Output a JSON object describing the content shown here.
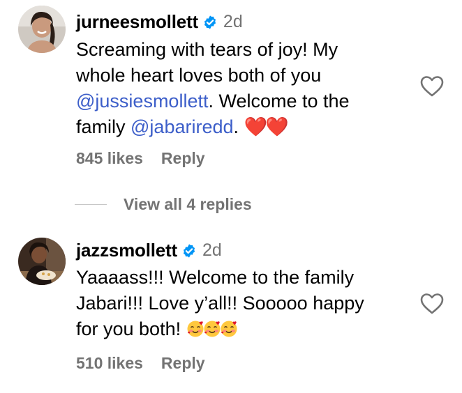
{
  "comments": [
    {
      "username": "jurneesmollett",
      "time": "2d",
      "avatar_icon": "profile-photo-woman-smiling",
      "text_lines": [
        {
          "parts": [
            {
              "t": "Screaming with tears of joy! My"
            }
          ]
        },
        {
          "parts": [
            {
              "t": "whole heart loves both of you"
            }
          ]
        },
        {
          "parts": [
            {
              "t": "@jussiesmollett",
              "mention": true
            },
            {
              "t": ". Welcome to the"
            }
          ]
        },
        {
          "parts": [
            {
              "t": "family "
            },
            {
              "t": "@jabariredd",
              "mention": true
            },
            {
              "t": ". "
            },
            {
              "t": "❤️❤️",
              "hearts": true
            }
          ]
        }
      ],
      "likes": "845 likes",
      "reply_label": "Reply",
      "view_replies": "View all 4 replies"
    },
    {
      "username": "jazzsmollett",
      "time": "2d",
      "avatar_icon": "profile-photo-woman-with-cake",
      "text_lines": [
        {
          "parts": [
            {
              "t": "Yaaaass!!! Welcome to the family"
            }
          ]
        },
        {
          "parts": [
            {
              "t": "Jabari!!! Love y’all!! Sooooo happy"
            }
          ]
        },
        {
          "parts": [
            {
              "t": "for you both! "
            },
            {
              "t": "🥰🥰🥰",
              "faces": 3
            }
          ]
        }
      ],
      "likes": "510 likes",
      "reply_label": "Reply"
    }
  ],
  "colors": {
    "verified": "#0095f6",
    "mention": "#3c5ec9",
    "muted": "#737373"
  },
  "icons": {
    "verified": "verified-badge-icon",
    "like": "heart-outline-icon"
  }
}
